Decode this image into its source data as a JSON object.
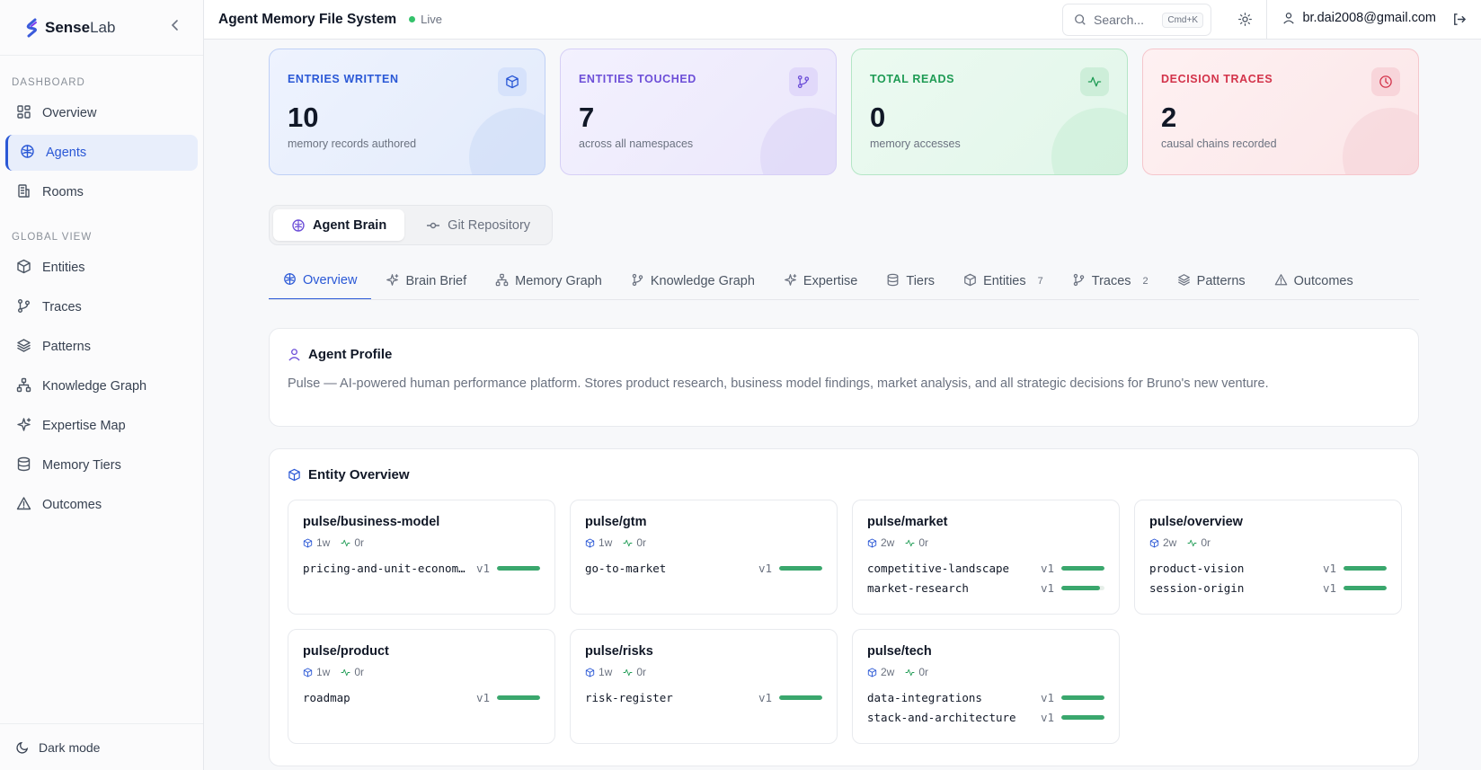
{
  "brand": {
    "name_bold": "Sense",
    "name_light": "Lab"
  },
  "sidebar": {
    "sections": [
      {
        "label": "DASHBOARD",
        "items": [
          {
            "label": "Overview",
            "icon": "grid-icon"
          },
          {
            "label": "Agents",
            "icon": "brain-icon",
            "active": true
          },
          {
            "label": "Rooms",
            "icon": "building-icon"
          }
        ]
      },
      {
        "label": "GLOBAL VIEW",
        "items": [
          {
            "label": "Entities",
            "icon": "cube-icon"
          },
          {
            "label": "Traces",
            "icon": "git-branch-icon"
          },
          {
            "label": "Patterns",
            "icon": "layers-icon"
          },
          {
            "label": "Knowledge Graph",
            "icon": "network-icon"
          },
          {
            "label": "Expertise Map",
            "icon": "sparkles-icon"
          },
          {
            "label": "Memory Tiers",
            "icon": "database-icon"
          },
          {
            "label": "Outcomes",
            "icon": "alert-triangle-icon"
          }
        ]
      }
    ],
    "dark_mode": "Dark mode"
  },
  "header": {
    "title": "Agent Memory File System",
    "status": "Live",
    "search_placeholder": "Search...",
    "search_shortcut": "Cmd+K",
    "user_email": "br.dai2008@gmail.com"
  },
  "stats": [
    {
      "label": "ENTRIES WRITTEN",
      "value": "10",
      "sub": "memory records authored",
      "icon": "cube-icon"
    },
    {
      "label": "ENTITIES TOUCHED",
      "value": "7",
      "sub": "across all namespaces",
      "icon": "git-branch-icon"
    },
    {
      "label": "TOTAL READS",
      "value": "0",
      "sub": "memory accesses",
      "icon": "activity-icon"
    },
    {
      "label": "DECISION TRACES",
      "value": "2",
      "sub": "causal chains recorded",
      "icon": "clock-icon"
    }
  ],
  "view_toggle": {
    "agent_brain": "Agent Brain",
    "git_repository": "Git Repository"
  },
  "tabs": [
    {
      "label": "Overview",
      "active": true,
      "count": ""
    },
    {
      "label": "Brain Brief",
      "count": ""
    },
    {
      "label": "Memory Graph",
      "count": ""
    },
    {
      "label": "Knowledge Graph",
      "count": ""
    },
    {
      "label": "Expertise",
      "count": ""
    },
    {
      "label": "Tiers",
      "count": ""
    },
    {
      "label": "Entities",
      "count": "7"
    },
    {
      "label": "Traces",
      "count": "2"
    },
    {
      "label": "Patterns",
      "count": ""
    },
    {
      "label": "Outcomes",
      "count": ""
    }
  ],
  "profile": {
    "title": "Agent Profile",
    "description": "Pulse — AI-powered human performance platform. Stores product research, business model findings, market analysis, and all strategic decisions for Bruno's new venture."
  },
  "entity_overview": {
    "title": "Entity Overview",
    "entities": [
      {
        "name": "pulse/business-model",
        "age": "1w",
        "reads": "0r",
        "records": [
          {
            "name": "pricing-and-unit-economi…",
            "version": "v1",
            "strength": 1.0
          }
        ]
      },
      {
        "name": "pulse/gtm",
        "age": "1w",
        "reads": "0r",
        "records": [
          {
            "name": "go-to-market",
            "version": "v1",
            "strength": 1.0
          }
        ]
      },
      {
        "name": "pulse/market",
        "age": "2w",
        "reads": "0r",
        "records": [
          {
            "name": "competitive-landscape",
            "version": "v1",
            "strength": 1.0
          },
          {
            "name": "market-research",
            "version": "v1",
            "strength": 0.9
          }
        ]
      },
      {
        "name": "pulse/overview",
        "age": "2w",
        "reads": "0r",
        "records": [
          {
            "name": "product-vision",
            "version": "v1",
            "strength": 1.0
          },
          {
            "name": "session-origin",
            "version": "v1",
            "strength": 1.0
          }
        ]
      },
      {
        "name": "pulse/product",
        "age": "1w",
        "reads": "0r",
        "records": [
          {
            "name": "roadmap",
            "version": "v1",
            "strength": 1.0
          }
        ]
      },
      {
        "name": "pulse/risks",
        "age": "1w",
        "reads": "0r",
        "records": [
          {
            "name": "risk-register",
            "version": "v1",
            "strength": 1.0
          }
        ]
      },
      {
        "name": "pulse/tech",
        "age": "2w",
        "reads": "0r",
        "records": [
          {
            "name": "data-integrations",
            "version": "v1",
            "strength": 1.0
          },
          {
            "name": "stack-and-architecture",
            "version": "v1",
            "strength": 1.0
          }
        ]
      }
    ]
  },
  "colors": {
    "accent": "#2a58d6",
    "live": "#34c26b",
    "bar": "#3aa76d"
  }
}
